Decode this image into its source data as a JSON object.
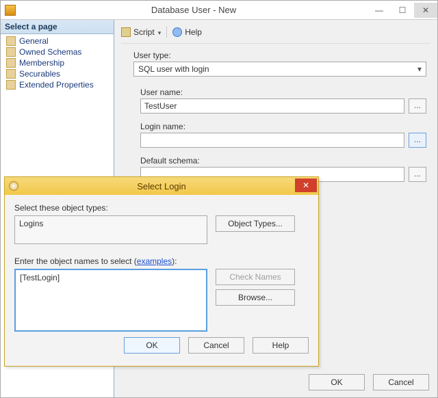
{
  "window": {
    "title": "Database User - New"
  },
  "sidebar": {
    "header": "Select a page",
    "items": [
      {
        "label": "General"
      },
      {
        "label": "Owned Schemas"
      },
      {
        "label": "Membership"
      },
      {
        "label": "Securables"
      },
      {
        "label": "Extended Properties"
      }
    ]
  },
  "toolbar": {
    "script": "Script",
    "help": "Help"
  },
  "form": {
    "usertype_label": "User type:",
    "usertype_value": "SQL user with login",
    "username_label": "User name:",
    "username_value": "TestUser",
    "loginname_label": "Login name:",
    "loginname_value": "",
    "defaultschema_label": "Default schema:",
    "defaultschema_value": "",
    "browse_dots": "..."
  },
  "mainbuttons": {
    "ok": "OK",
    "cancel": "Cancel"
  },
  "modal": {
    "title": "Select Login",
    "objtypes_label": "Select these object types:",
    "objtypes_value": "Logins",
    "objtypes_btn": "Object Types...",
    "names_label_pre": "Enter the object names to select (",
    "names_label_link": "examples",
    "names_label_post": "):",
    "names_value": "[TestLogin]",
    "checknames": "Check Names",
    "browse": "Browse...",
    "ok": "OK",
    "cancel": "Cancel",
    "help": "Help"
  }
}
